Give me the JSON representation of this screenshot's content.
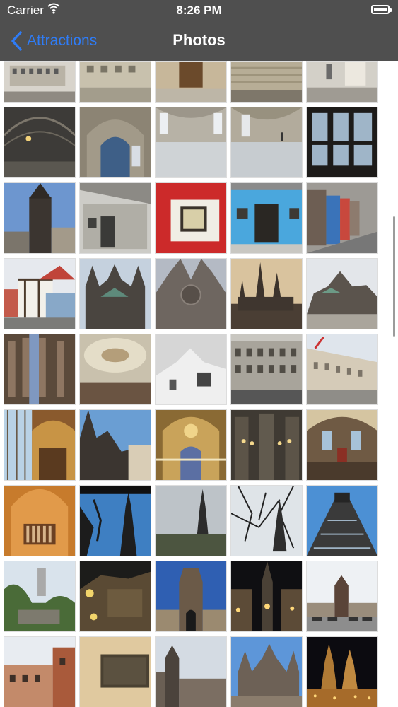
{
  "status_bar": {
    "carrier": "Carrier",
    "time": "8:26 PM"
  },
  "nav": {
    "back_label": "Attractions",
    "title": "Photos"
  },
  "colors": {
    "bar": "#4f4f4f",
    "accent": "#2f7cf6"
  },
  "icons": [
    "wifi-icon",
    "battery-icon",
    "chevron-left-icon"
  ]
}
